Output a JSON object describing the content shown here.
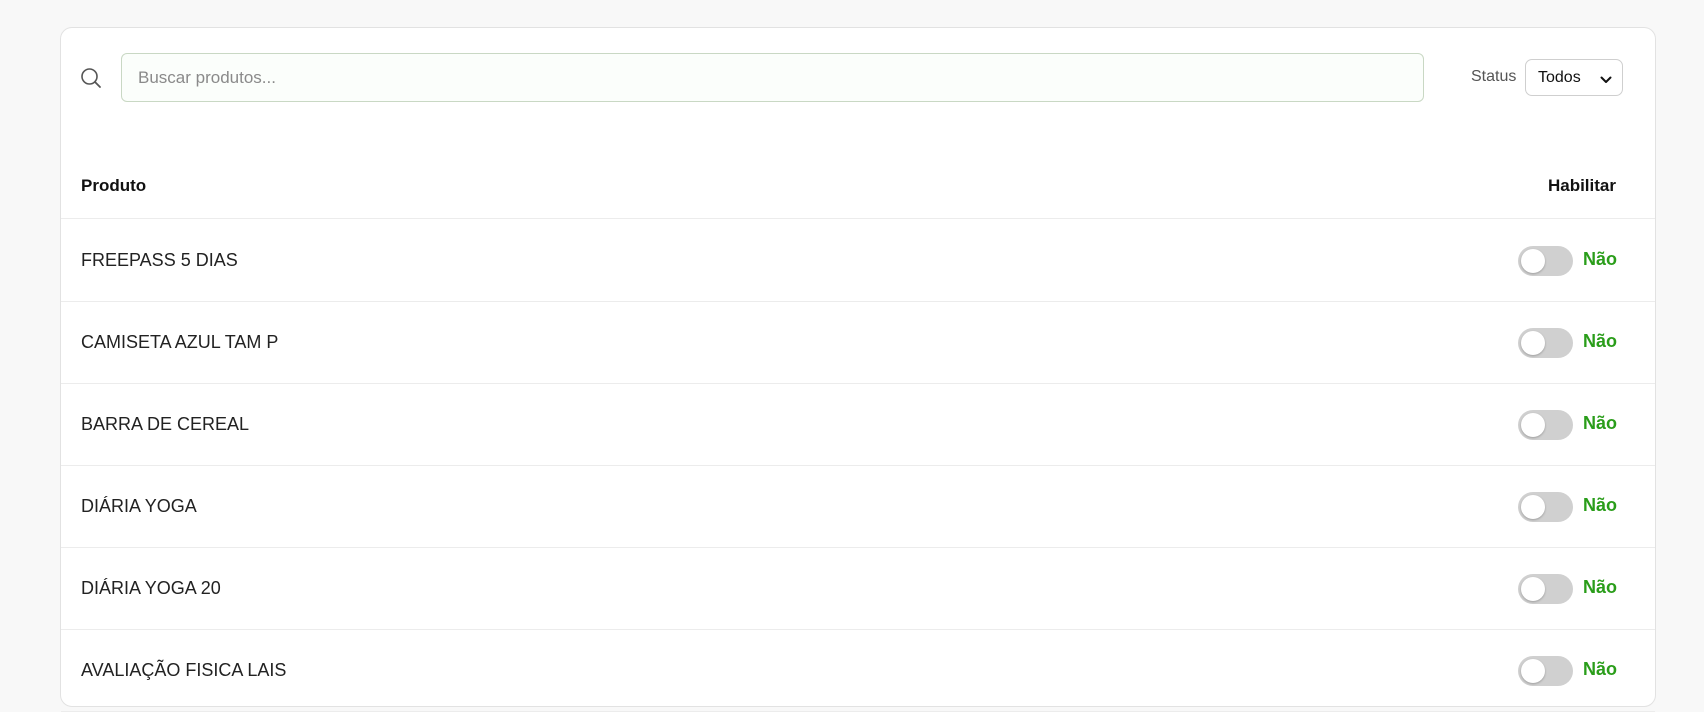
{
  "search": {
    "placeholder": "Buscar produtos...",
    "value": ""
  },
  "filter": {
    "label": "Status",
    "selected": "Todos"
  },
  "table": {
    "headers": {
      "product": "Produto",
      "enable": "Habilitar"
    },
    "rows": [
      {
        "name": "FREEPASS 5 DIAS",
        "enabled": false,
        "state": "Não"
      },
      {
        "name": "CAMISETA AZUL TAM P",
        "enabled": false,
        "state": "Não"
      },
      {
        "name": "BARRA DE CEREAL",
        "enabled": false,
        "state": "Não"
      },
      {
        "name": "DIÁRIA YOGA",
        "enabled": false,
        "state": "Não"
      },
      {
        "name": "DIÁRIA YOGA 20",
        "enabled": false,
        "state": "Não"
      },
      {
        "name": "AVALIAÇÃO FISICA LAIS",
        "enabled": false,
        "state": "Não"
      }
    ]
  },
  "colors": {
    "state_text": "#2a9d1a",
    "toggle_off": "#d0d0d0"
  }
}
